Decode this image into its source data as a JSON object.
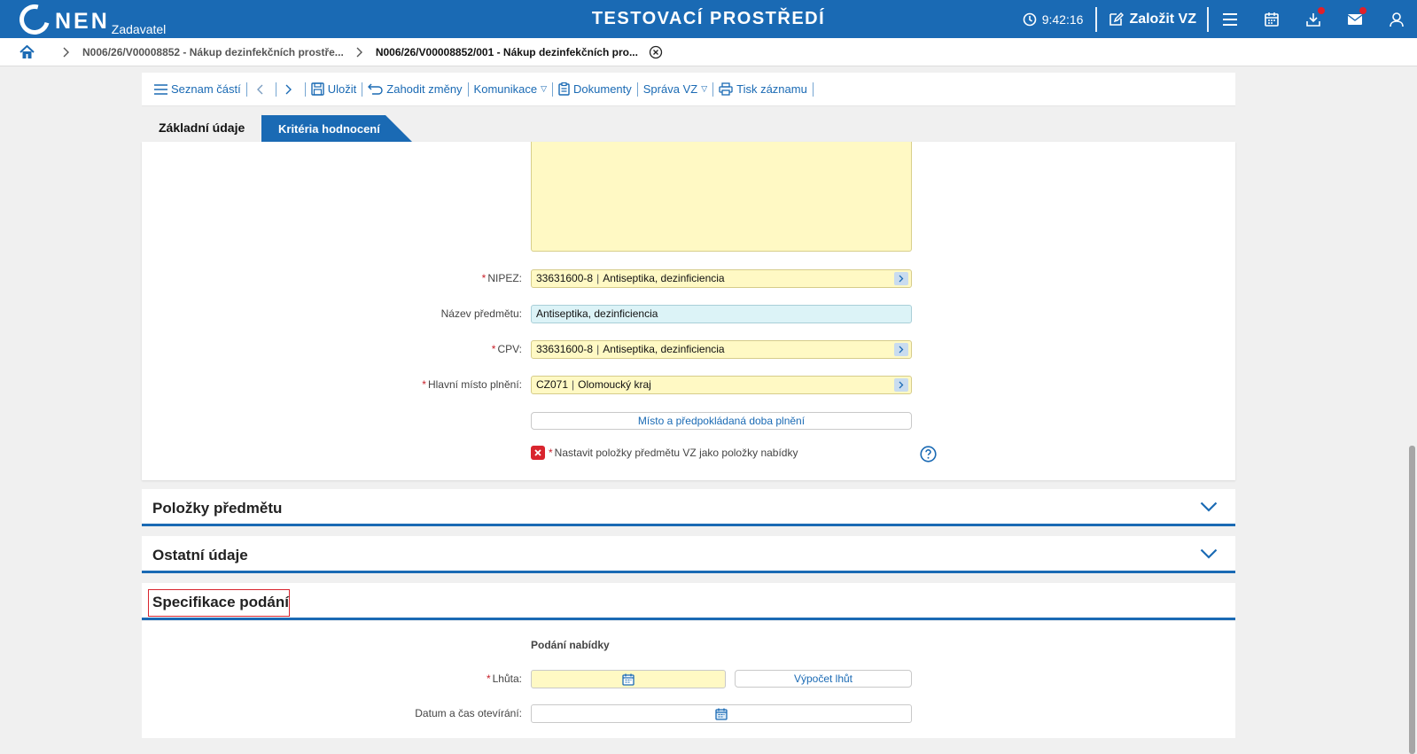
{
  "header": {
    "logo_text": "NEN",
    "logo_sub": "Zadavatel",
    "environment_title": "TESTOVACÍ PROSTŘEDÍ",
    "time": "9:42:16",
    "create_label": "Založit VZ",
    "accent_color": "#1a6ab4"
  },
  "breadcrumb": {
    "items": [
      "N006/26/V00008852 - Nákup dezinfekčních prostře...",
      "N006/26/V00008852/001 - Nákup dezinfekčních pro..."
    ]
  },
  "toolbar": {
    "parts_list": "Seznam částí",
    "save": "Uložit",
    "discard": "Zahodit změny",
    "communication": "Komunikace",
    "documents": "Dokumenty",
    "management": "Správa VZ",
    "print": "Tisk záznamu"
  },
  "tabs": {
    "basic": "Základní údaje",
    "criteria": "Kritéria hodnocení"
  },
  "form": {
    "nipez": {
      "label": "NIPEZ:",
      "code": "33631600-8",
      "text": "Antiseptika, dezinficiencia"
    },
    "subject_name": {
      "label": "Název předmětu:",
      "value": "Antiseptika, dezinficiencia"
    },
    "cpv": {
      "label": "CPV:",
      "code": "33631600-8",
      "text": "Antiseptika, dezinficiencia"
    },
    "main_place": {
      "label": "Hlavní místo plnění:",
      "code": "CZ071",
      "text": "Olomoucký kraj"
    },
    "place_button": "Místo a předpokládaná doba plnění",
    "set_items_label": "Nastavit položky předmětu VZ jako položky nabídky"
  },
  "sections": {
    "subject_items": "Položky předmětu",
    "other_data": "Ostatní údaje",
    "submission_spec": "Specifikace podání"
  },
  "submission": {
    "heading": "Podání nabídky",
    "deadline_label": "Lhůta:",
    "calc_button": "Výpočet lhůt",
    "opening_label": "Datum a čas otevírání:"
  }
}
